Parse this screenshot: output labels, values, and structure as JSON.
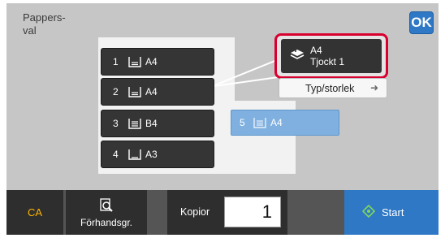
{
  "title": "Pappers-\nval",
  "ok_label": "OK",
  "trays": [
    {
      "num": "1",
      "size": "A4"
    },
    {
      "num": "2",
      "size": "A4"
    },
    {
      "num": "3",
      "size": "B4"
    },
    {
      "num": "4",
      "size": "A3"
    }
  ],
  "bypass": {
    "num": "5",
    "size": "A4"
  },
  "selected": {
    "line1": "A4",
    "line2": "Tjockt 1"
  },
  "type_size_label": "Typ/storlek",
  "bottom": {
    "ca": "CA",
    "preview": "Förhandsgr.",
    "copies_label": "Kopior",
    "copies_value": "1",
    "start": "Start"
  },
  "colors": {
    "accent": "#2f78c5",
    "highlight": "#d9002f",
    "bypass": "#7fb0e0",
    "ca_text": "#ffb400"
  }
}
